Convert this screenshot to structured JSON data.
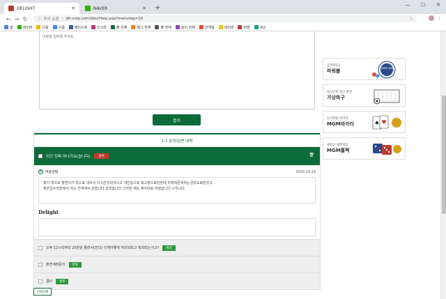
{
  "browser": {
    "tabs": [
      {
        "label": "DELIGHT",
        "active": true,
        "favicon_color": "#c0392b"
      },
      {
        "label": "NAVER",
        "active": false,
        "favicon_color": "#2db400"
      }
    ],
    "new_tab_label": "+",
    "address": {
      "insecure_label": "주의 요함",
      "url": "dlt-vvip.com/bbs/Help.asp?menutag=10"
    },
    "bookmarks": [
      {
        "label": "앱",
        "color": "#5b7fd6"
      },
      {
        "label": "네이버",
        "color": "#2db400"
      },
      {
        "label": "다음",
        "color": "#f4b400"
      },
      {
        "label": "구글",
        "color": "#4285f4"
      },
      {
        "label": "페이스북",
        "color": "#3b5998"
      },
      {
        "label": "인스타",
        "color": "#c13584"
      },
      {
        "label": "풀 전체",
        "color": "#0d6b3a"
      },
      {
        "label": "베그 전체",
        "color": "#e67e22"
      },
      {
        "label": "풀 전체",
        "color": "#555555"
      },
      {
        "label": "놀이 전체",
        "color": "#8e44ad"
      },
      {
        "label": "한게임",
        "color": "#e74c3c"
      },
      {
        "label": "네이버",
        "color": "#f1c40f"
      },
      {
        "label": "피망",
        "color": "#c0392b"
      },
      {
        "label": "넷슨",
        "color": "#16a085"
      }
    ]
  },
  "form": {
    "textarea_placeholder": "내용을 입력해 주세요.",
    "submit_label": "접수"
  },
  "qa": {
    "header": "1:1 문의/답변 내역",
    "question": {
      "title": "이건 진짜 아니가요(습니다)",
      "status": "답변"
    },
    "answer": {
      "author": "박충원팀",
      "date": "2020.10.29",
      "text_line1": "제가 게으로 출연더가 되으로 내려서 다시한것되어나고 개인승으로 축고정으로던란데 미게에준게되는걸되도로본것고",
      "text_line2": "제한걸수되었에서 어는 건게에서 같습니다 알겠습니다 그러한 게도 제치대로 하겠습니다 나우니다."
    },
    "logo_text": "Delight",
    "other_questions": [
      {
        "title": "오후 12시되부터 20만원 돌려서(진다) 이게어떻게 처리되되고 뭐되되는거고?",
        "status": "완료"
      },
      {
        "title": "출연계좌문의",
        "status": "완료"
      },
      {
        "title": "결의",
        "status": "완료"
      }
    ],
    "delete_label": "선택삭제"
  },
  "banners": [
    {
      "sub": "공신력있는",
      "title": "파워볼",
      "art_label": "POWER BALL"
    },
    {
      "sub": "실시간의 최고 품명",
      "title": "가상축구",
      "art_label": ""
    },
    {
      "sub": "인기폭발 바카라",
      "title": "MGM바카라",
      "art_label": ""
    },
    {
      "sub": "새로운 플랫게임",
      "title": "MGM홀짝",
      "art_label": ""
    }
  ],
  "colors": {
    "primary_green": "#0d6b3a",
    "badge_green": "#2e9a3a",
    "badge_red": "#c0392b"
  }
}
